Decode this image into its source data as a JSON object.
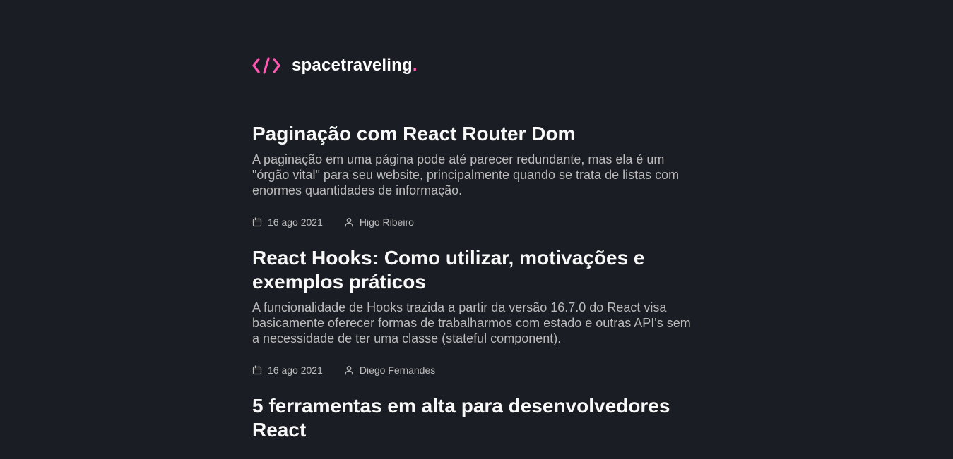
{
  "header": {
    "brand": "spacetraveling",
    "brand_dot": ".",
    "logo_icon": "code-brackets-icon",
    "accent_color": "#ff57b2"
  },
  "posts": [
    {
      "title": "Paginação com React Router Dom",
      "subtitle": "A paginação em uma página pode até parecer redundante, mas ela é um \"órgão vital\" para seu website, principalmente quando se trata de listas com enormes quantidades de informação.",
      "date": "16 ago 2021",
      "author": "Higo Ribeiro"
    },
    {
      "title": "React Hooks: Como utilizar, motivações e exemplos práticos",
      "subtitle": "A funcionalidade de Hooks trazida a partir da versão 16.7.0 do React visa basicamente oferecer formas de trabalharmos com estado e outras API's sem a necessidade de ter uma classe (stateful component).",
      "date": "16 ago 2021",
      "author": "Diego Fernandes"
    },
    {
      "title": "5 ferramentas em alta para desenvolvedores React",
      "subtitle": "",
      "date": "",
      "author": ""
    }
  ],
  "icons": {
    "date": "calendar-icon",
    "author": "user-icon"
  },
  "colors": {
    "background": "#1a1d23",
    "title": "#f8f8f8",
    "body": "#bbbbbb"
  }
}
